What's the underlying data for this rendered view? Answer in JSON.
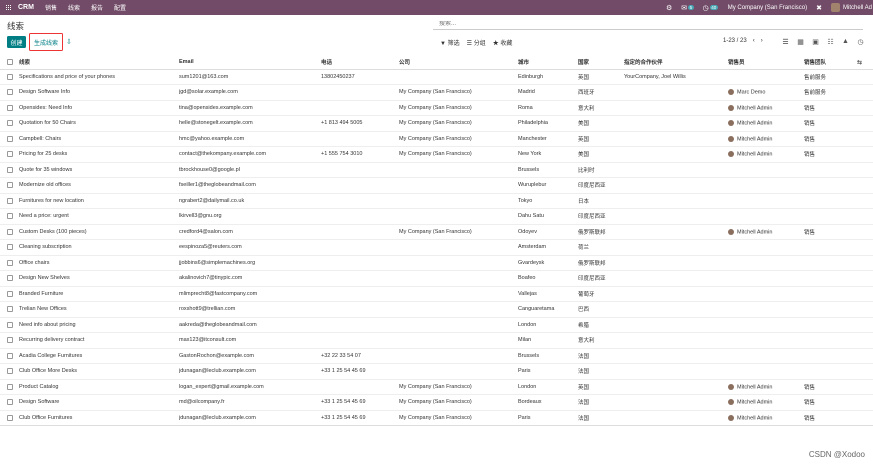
{
  "navbar": {
    "brand": "CRM",
    "menu": [
      "销售",
      "线索",
      "报告",
      "配置"
    ],
    "chat_badge": "5",
    "activity_badge": "40",
    "company": "My Company (San Francisco)",
    "user": "Mitchell Ad"
  },
  "control": {
    "breadcrumb": "线索",
    "search_placeholder": "搜索...",
    "create_label": "创建",
    "generate_label": "生成线索",
    "filter_label": "筛选",
    "group_label": "分组",
    "favorites_label": "收藏",
    "pager": "1-23 / 23"
  },
  "table": {
    "headers": [
      "线索",
      "Email",
      "电话",
      "公司",
      "城市",
      "国家",
      "指定的合作伙伴",
      "销售员",
      "销售团队"
    ],
    "rows": [
      [
        "Specifications and price of your phones",
        "sum1201@163.com",
        "13802450237",
        "",
        "Edinburgh",
        "英国",
        "YourCompany, Joel Willis",
        "",
        "售前服务"
      ],
      [
        "Design Software Info",
        "jgd@solar.example.com",
        "",
        "My Company (San Francisco)",
        "Madrid",
        "西班牙",
        "",
        "Marc Demo",
        "售前服务"
      ],
      [
        "Opensides: Need Info",
        "tina@opensides.example.com",
        "",
        "My Company (San Francisco)",
        "Roma",
        "意大利",
        "",
        "Mitchell Admin",
        "销售"
      ],
      [
        "Quotation for 50 Chairs",
        "helle@stonegelt.example.com",
        "+1 813 494 5005",
        "My Company (San Francisco)",
        "Philadelphia",
        "美国",
        "",
        "Mitchell Admin",
        "销售"
      ],
      [
        "Campbell: Chairs",
        "hmc@yahoo.example.com",
        "",
        "My Company (San Francisco)",
        "Manchester",
        "英国",
        "",
        "Mitchell Admin",
        "销售"
      ],
      [
        "Pricing for 25 desks",
        "contact@thekompany.example.com",
        "+1 555 754 3010",
        "My Company (San Francisco)",
        "New York",
        "美国",
        "",
        "Mitchell Admin",
        "销售"
      ],
      [
        "Quote for 35 windows",
        "tbrockhouse0@google.pl",
        "",
        "",
        "Brussels",
        "比利时",
        "",
        "",
        ""
      ],
      [
        "Modernize old offices",
        "fseiller1@theglobeandmail.com",
        "",
        "",
        "Wuruplebur",
        "印度尼西亚",
        "",
        "",
        ""
      ],
      [
        "Furnitures for new location",
        "ngrabert2@dailymail.co.uk",
        "",
        "",
        "Tokyo",
        "日本",
        "",
        "",
        ""
      ],
      [
        "Need a price: urgent",
        "lkirvell3@gnu.org",
        "",
        "",
        "Dahu Satu",
        "印度尼西亚",
        "",
        "",
        ""
      ],
      [
        "Custom Desks (100 pieces)",
        "credford4@salon.com",
        "",
        "My Company (San Francisco)",
        "Odoyev",
        "俄罗斯联邦",
        "",
        "Mitchell Admin",
        "销售"
      ],
      [
        "Cleaning subscription",
        "eespinoza5@reuters.com",
        "",
        "",
        "Amsterdam",
        "荷兰",
        "",
        "",
        ""
      ],
      [
        "Office chairs",
        "jjobbins6@simplemachines.org",
        "",
        "",
        "Gvardeysk",
        "俄罗斯联邦",
        "",
        "",
        ""
      ],
      [
        "Design New Shelves",
        "akalinovich7@tinypic.com",
        "",
        "",
        "Boafeo",
        "印度尼西亚",
        "",
        "",
        ""
      ],
      [
        "Branded Furniture",
        "mlimprecht8@fastcompany.com",
        "",
        "",
        "Vallejas",
        "葡萄牙",
        "",
        "",
        ""
      ],
      [
        "Trelian New Offices",
        "roxshott9@trellian.com",
        "",
        "",
        "Canguaretama",
        "巴西",
        "",
        "",
        ""
      ],
      [
        "Need info about pricing",
        "aakreda@theglobeandmail.com",
        "",
        "",
        "London",
        "希腊",
        "",
        "",
        ""
      ],
      [
        "Recurring delivery contract",
        "max123@itconsult.com",
        "",
        "",
        "Milan",
        "意大利",
        "",
        "",
        ""
      ],
      [
        "Acadia College Furnitures",
        "GastonRochon@example.com",
        "+32 22 33 54 07",
        "",
        "Brussels",
        "法国",
        "",
        "",
        ""
      ],
      [
        "Club Office More Desks",
        "jdunagan@leclub.example.com",
        "+33 1 25 54 45 69",
        "",
        "Paris",
        "法国",
        "",
        "",
        ""
      ],
      [
        "Product Catalog",
        "logan_expert@gmail.example.com",
        "",
        "My Company (San Francisco)",
        "London",
        "英国",
        "",
        "Mitchell Admin",
        "销售"
      ],
      [
        "Design Software",
        "md@oilcompany.fr",
        "+33 1 25 54 45 69",
        "My Company (San Francisco)",
        "Bordeaux",
        "法国",
        "",
        "Mitchell Admin",
        "销售"
      ],
      [
        "Club Office Furnitures",
        "jdunagan@leclub.example.com",
        "+33 1 25 54 45 69",
        "My Company (San Francisco)",
        "Paris",
        "法国",
        "",
        "Mitchell Admin",
        "销售"
      ]
    ]
  },
  "watermark": "CSDN @Xodoo",
  "colors": {
    "navbar": "#714B67",
    "primary": "#017e84",
    "highlight": "#ee3333"
  }
}
